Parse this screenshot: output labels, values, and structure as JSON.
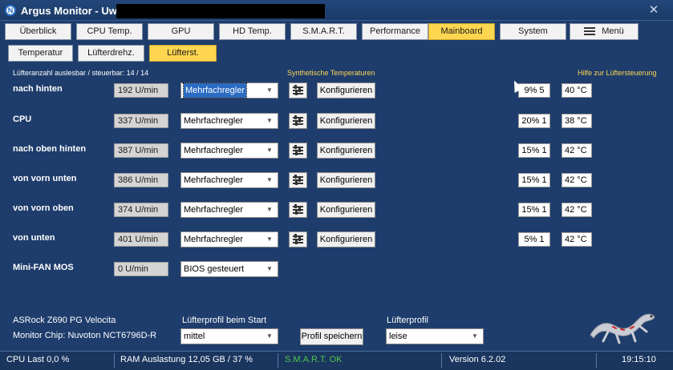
{
  "window": {
    "title": "Argus Monitor - Uwe",
    "close": "✕"
  },
  "tabs_main": [
    {
      "label": "Überblick"
    },
    {
      "label": "CPU Temp."
    },
    {
      "label": "GPU"
    },
    {
      "label": "HD Temp."
    },
    {
      "label": "S.M.A.R.T."
    },
    {
      "label": "Performance"
    },
    {
      "label": "Mainboard",
      "active": true
    },
    {
      "label": "System"
    },
    {
      "label": "Menü"
    }
  ],
  "tabs_sub": [
    {
      "label": "Temperatur"
    },
    {
      "label": "Lüfterdrehz."
    },
    {
      "label": "Lüfterst.",
      "active": true
    }
  ],
  "header": {
    "count": "Lüfteranzahl auslesbar / steuerbar: 14 / 14",
    "synth_link": "Synthetische Temperaturen",
    "help_link": "Hilfe zur Lüftersteuerung"
  },
  "fans": [
    {
      "name": "nach hinten",
      "rpm": "192 U/min",
      "control": "Mehrfachregler",
      "configure": "Konfigurieren",
      "percent": "9% 5",
      "temp": "40 °C"
    },
    {
      "name": "CPU",
      "rpm": "337 U/min",
      "control": "Mehrfachregler",
      "configure": "Konfigurieren",
      "percent": "20% 1",
      "temp": "38 °C"
    },
    {
      "name": "nach oben hinten",
      "rpm": "387 U/min",
      "control": "Mehrfachregler",
      "configure": "Konfigurieren",
      "percent": "15% 1",
      "temp": "42 °C"
    },
    {
      "name": "von vorn unten",
      "rpm": "386 U/min",
      "control": "Mehrfachregler",
      "configure": "Konfigurieren",
      "percent": "15% 1",
      "temp": "42 °C"
    },
    {
      "name": "von vorn oben",
      "rpm": "374 U/min",
      "control": "Mehrfachregler",
      "configure": "Konfigurieren",
      "percent": "15% 1",
      "temp": "42 °C"
    },
    {
      "name": "von unten",
      "rpm": "401 U/min",
      "control": "Mehrfachregler",
      "configure": "Konfigurieren",
      "percent": "5% 1",
      "temp": "42 °C"
    },
    {
      "name": "Mini-FAN MOS",
      "rpm": "0 U/min",
      "control": "BIOS gesteuert"
    }
  ],
  "footer": {
    "board": "ASRock Z690 PG Velocita",
    "chip": "Monitor Chip: Nuvoton NCT6796D-R",
    "start_profile_label": "Lüfterprofil beim Start",
    "start_profile_value": "mittel",
    "save_button": "Profil speichern",
    "profile_label": "Lüfterprofil",
    "profile_value": "leise"
  },
  "status": {
    "cpu_load": "CPU Last 0,0 %",
    "ram": "RAM Auslastung 12,05 GB / 37 %",
    "smart": "S.M.A.R.T. OK",
    "version": "Version 6.2.02",
    "time": "19:15:10"
  },
  "colors": {
    "background": "#1e3d6c",
    "active_tab": "#ffd650",
    "link": "#ffd650",
    "status_ok": "#4ec94e"
  },
  "icons": {
    "app": "argus-logo-icon",
    "close": "close-icon",
    "menu": "hamburger-icon",
    "settings": "sliders-icon",
    "dropdown": "chevron-down-icon",
    "mascot": "gecko-logo-icon"
  }
}
